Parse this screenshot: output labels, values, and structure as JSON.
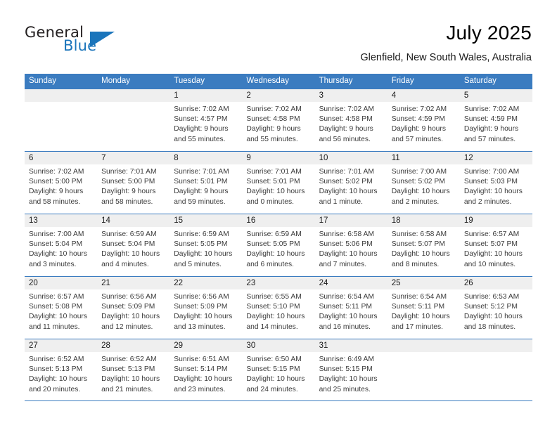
{
  "brand": {
    "word1": "General",
    "word2": "Blue",
    "accent_color": "#1b75bb"
  },
  "header": {
    "title": "July 2025",
    "location": "Glenfield, New South Wales, Australia"
  },
  "calendar": {
    "header_bg": "#3b7cc0",
    "weekdays": [
      "Sunday",
      "Monday",
      "Tuesday",
      "Wednesday",
      "Thursday",
      "Friday",
      "Saturday"
    ],
    "weeks": [
      [
        {
          "day": "",
          "lines": []
        },
        {
          "day": "",
          "lines": []
        },
        {
          "day": "1",
          "lines": [
            "Sunrise: 7:02 AM",
            "Sunset: 4:57 PM",
            "Daylight: 9 hours",
            "and 55 minutes."
          ]
        },
        {
          "day": "2",
          "lines": [
            "Sunrise: 7:02 AM",
            "Sunset: 4:58 PM",
            "Daylight: 9 hours",
            "and 55 minutes."
          ]
        },
        {
          "day": "3",
          "lines": [
            "Sunrise: 7:02 AM",
            "Sunset: 4:58 PM",
            "Daylight: 9 hours",
            "and 56 minutes."
          ]
        },
        {
          "day": "4",
          "lines": [
            "Sunrise: 7:02 AM",
            "Sunset: 4:59 PM",
            "Daylight: 9 hours",
            "and 57 minutes."
          ]
        },
        {
          "day": "5",
          "lines": [
            "Sunrise: 7:02 AM",
            "Sunset: 4:59 PM",
            "Daylight: 9 hours",
            "and 57 minutes."
          ]
        }
      ],
      [
        {
          "day": "6",
          "lines": [
            "Sunrise: 7:02 AM",
            "Sunset: 5:00 PM",
            "Daylight: 9 hours",
            "and 58 minutes."
          ]
        },
        {
          "day": "7",
          "lines": [
            "Sunrise: 7:01 AM",
            "Sunset: 5:00 PM",
            "Daylight: 9 hours",
            "and 58 minutes."
          ]
        },
        {
          "day": "8",
          "lines": [
            "Sunrise: 7:01 AM",
            "Sunset: 5:01 PM",
            "Daylight: 9 hours",
            "and 59 minutes."
          ]
        },
        {
          "day": "9",
          "lines": [
            "Sunrise: 7:01 AM",
            "Sunset: 5:01 PM",
            "Daylight: 10 hours",
            "and 0 minutes."
          ]
        },
        {
          "day": "10",
          "lines": [
            "Sunrise: 7:01 AM",
            "Sunset: 5:02 PM",
            "Daylight: 10 hours",
            "and 1 minute."
          ]
        },
        {
          "day": "11",
          "lines": [
            "Sunrise: 7:00 AM",
            "Sunset: 5:02 PM",
            "Daylight: 10 hours",
            "and 2 minutes."
          ]
        },
        {
          "day": "12",
          "lines": [
            "Sunrise: 7:00 AM",
            "Sunset: 5:03 PM",
            "Daylight: 10 hours",
            "and 2 minutes."
          ]
        }
      ],
      [
        {
          "day": "13",
          "lines": [
            "Sunrise: 7:00 AM",
            "Sunset: 5:04 PM",
            "Daylight: 10 hours",
            "and 3 minutes."
          ]
        },
        {
          "day": "14",
          "lines": [
            "Sunrise: 6:59 AM",
            "Sunset: 5:04 PM",
            "Daylight: 10 hours",
            "and 4 minutes."
          ]
        },
        {
          "day": "15",
          "lines": [
            "Sunrise: 6:59 AM",
            "Sunset: 5:05 PM",
            "Daylight: 10 hours",
            "and 5 minutes."
          ]
        },
        {
          "day": "16",
          "lines": [
            "Sunrise: 6:59 AM",
            "Sunset: 5:05 PM",
            "Daylight: 10 hours",
            "and 6 minutes."
          ]
        },
        {
          "day": "17",
          "lines": [
            "Sunrise: 6:58 AM",
            "Sunset: 5:06 PM",
            "Daylight: 10 hours",
            "and 7 minutes."
          ]
        },
        {
          "day": "18",
          "lines": [
            "Sunrise: 6:58 AM",
            "Sunset: 5:07 PM",
            "Daylight: 10 hours",
            "and 8 minutes."
          ]
        },
        {
          "day": "19",
          "lines": [
            "Sunrise: 6:57 AM",
            "Sunset: 5:07 PM",
            "Daylight: 10 hours",
            "and 10 minutes."
          ]
        }
      ],
      [
        {
          "day": "20",
          "lines": [
            "Sunrise: 6:57 AM",
            "Sunset: 5:08 PM",
            "Daylight: 10 hours",
            "and 11 minutes."
          ]
        },
        {
          "day": "21",
          "lines": [
            "Sunrise: 6:56 AM",
            "Sunset: 5:09 PM",
            "Daylight: 10 hours",
            "and 12 minutes."
          ]
        },
        {
          "day": "22",
          "lines": [
            "Sunrise: 6:56 AM",
            "Sunset: 5:09 PM",
            "Daylight: 10 hours",
            "and 13 minutes."
          ]
        },
        {
          "day": "23",
          "lines": [
            "Sunrise: 6:55 AM",
            "Sunset: 5:10 PM",
            "Daylight: 10 hours",
            "and 14 minutes."
          ]
        },
        {
          "day": "24",
          "lines": [
            "Sunrise: 6:54 AM",
            "Sunset: 5:11 PM",
            "Daylight: 10 hours",
            "and 16 minutes."
          ]
        },
        {
          "day": "25",
          "lines": [
            "Sunrise: 6:54 AM",
            "Sunset: 5:11 PM",
            "Daylight: 10 hours",
            "and 17 minutes."
          ]
        },
        {
          "day": "26",
          "lines": [
            "Sunrise: 6:53 AM",
            "Sunset: 5:12 PM",
            "Daylight: 10 hours",
            "and 18 minutes."
          ]
        }
      ],
      [
        {
          "day": "27",
          "lines": [
            "Sunrise: 6:52 AM",
            "Sunset: 5:13 PM",
            "Daylight: 10 hours",
            "and 20 minutes."
          ]
        },
        {
          "day": "28",
          "lines": [
            "Sunrise: 6:52 AM",
            "Sunset: 5:13 PM",
            "Daylight: 10 hours",
            "and 21 minutes."
          ]
        },
        {
          "day": "29",
          "lines": [
            "Sunrise: 6:51 AM",
            "Sunset: 5:14 PM",
            "Daylight: 10 hours",
            "and 23 minutes."
          ]
        },
        {
          "day": "30",
          "lines": [
            "Sunrise: 6:50 AM",
            "Sunset: 5:15 PM",
            "Daylight: 10 hours",
            "and 24 minutes."
          ]
        },
        {
          "day": "31",
          "lines": [
            "Sunrise: 6:49 AM",
            "Sunset: 5:15 PM",
            "Daylight: 10 hours",
            "and 25 minutes."
          ]
        },
        {
          "day": "",
          "lines": []
        },
        {
          "day": "",
          "lines": []
        }
      ]
    ]
  }
}
